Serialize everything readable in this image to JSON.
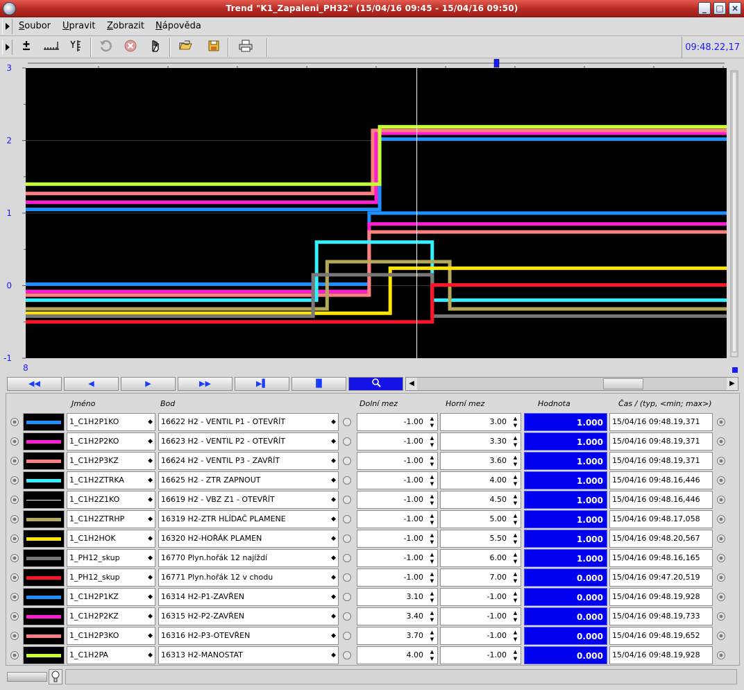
{
  "window": {
    "title": "Trend \"K1_Zapaleni_PH32\" (15/04/16 09:45 - 15/04/16 09:50)",
    "btn_minimize": "_",
    "btn_maximize": "□",
    "btn_close": "×"
  },
  "menu": [
    "Soubor",
    "Upravit",
    "Zobrazit",
    "Nápověda"
  ],
  "toolbar": {
    "clock": "09:48.22,17",
    "icons": [
      "plus-minus-icon",
      "time-axis-icon",
      "y-axis-icon",
      "undo-icon",
      "cancel-icon",
      "hand-icon",
      "open-icon",
      "save-icon",
      "print-icon"
    ]
  },
  "chart_data": {
    "type": "line",
    "x_range": [
      "09:45",
      "09:50"
    ],
    "ylim": [
      -1,
      3
    ],
    "y_ticks": [
      "3",
      "2",
      "1",
      "0",
      "-1"
    ],
    "x_start_label": "8",
    "cursor_x": "09:48.22,17",
    "grid": true,
    "background": "#000000",
    "series": [
      {
        "color": "#1e90ff",
        "steps": [
          {
            "t": 0.0,
            "y": 1.05
          },
          {
            "t": 0.505,
            "y": 2.02
          }
        ]
      },
      {
        "color": "#ff1ed2",
        "steps": [
          {
            "t": 0.0,
            "y": 1.15
          },
          {
            "t": 0.5,
            "y": 2.1
          }
        ]
      },
      {
        "color": "#ff8080",
        "steps": [
          {
            "t": 0.0,
            "y": 1.27
          },
          {
            "t": 0.495,
            "y": 2.14
          }
        ]
      },
      {
        "color": "#c8ff32",
        "steps": [
          {
            "t": 0.0,
            "y": 1.4
          },
          {
            "t": 0.505,
            "y": 2.19
          }
        ]
      },
      {
        "color": "#1e90ff",
        "steps": [
          {
            "t": 0.0,
            "y": 0.02
          },
          {
            "t": 0.49,
            "y": 1.0
          }
        ]
      },
      {
        "color": "#ff1ed2",
        "steps": [
          {
            "t": 0.0,
            "y": -0.08
          },
          {
            "t": 0.49,
            "y": 0.85
          }
        ]
      },
      {
        "color": "#ff8080",
        "steps": [
          {
            "t": 0.0,
            "y": -0.13
          },
          {
            "t": 0.49,
            "y": 0.74
          }
        ]
      },
      {
        "color": "#32f0ff",
        "steps": [
          {
            "t": 0.0,
            "y": -0.2
          },
          {
            "t": 0.415,
            "y": 0.6
          },
          {
            "t": 0.58,
            "y": -0.2
          }
        ]
      },
      {
        "color": "#b4aa5a",
        "steps": [
          {
            "t": 0.0,
            "y": -0.32
          },
          {
            "t": 0.43,
            "y": 0.33
          },
          {
            "t": 0.605,
            "y": -0.32
          }
        ]
      },
      {
        "color": "#ffe600",
        "steps": [
          {
            "t": 0.0,
            "y": -0.38
          },
          {
            "t": 0.52,
            "y": 0.24
          }
        ]
      },
      {
        "color": "#787878",
        "steps": [
          {
            "t": 0.0,
            "y": -0.42
          },
          {
            "t": 0.41,
            "y": 0.15
          },
          {
            "t": 0.58,
            "y": -0.42
          }
        ]
      },
      {
        "color": "#ff1428",
        "steps": [
          {
            "t": 0.0,
            "y": -0.5
          },
          {
            "t": 0.58,
            "y": 0.01
          }
        ]
      }
    ]
  },
  "nav": {
    "buttons": [
      "◀◀",
      "◀",
      "▶",
      "▶▶",
      "▶▌",
      "▐▌"
    ],
    "zoom_icon": "magnifier-icon"
  },
  "table": {
    "headers": {
      "name": "Jméno",
      "point": "Bod",
      "low": "Dolní mez",
      "high": "Horní mez",
      "value": "Hodnota",
      "time": "Čas / (typ, <min; max>)"
    },
    "rows": [
      {
        "color": "#1e90ff",
        "name": "1_C1H2P1KO",
        "point": "16622  H2 - VENTIL P1 - OTEVŘÍT",
        "low": "-1.00",
        "high": "3.00",
        "value": "1.000",
        "time": "15/04/16 09:48.19,371"
      },
      {
        "color": "#ff1ed2",
        "name": "1_C1H2P2KO",
        "point": "16623  H2 - VENTIL P2 - OTEVŘÍT",
        "low": "-1.00",
        "high": "3.30",
        "value": "1.000",
        "time": "15/04/16 09:48.19,371"
      },
      {
        "color": "#ff8080",
        "name": "1_C1H2P3KZ",
        "point": "16624  H2 - VENTIL P3 - ZAVŘÍT",
        "low": "-1.00",
        "high": "3.60",
        "value": "1.000",
        "time": "15/04/16 09:48.19,371"
      },
      {
        "color": "#32f0ff",
        "name": "1_C1H2ZTRKA",
        "point": "16625  H2 - ZTR ZAPNOUT",
        "low": "-1.00",
        "high": "4.00",
        "value": "1.000",
        "time": "15/04/16 09:48.16,446"
      },
      {
        "color": "#ffffff",
        "name": "1_C1H2Z1KO",
        "point": "16619  H2 - VBZ Z1 - OTEVŘÍT",
        "low": "-1.00",
        "high": "4.50",
        "value": "1.000",
        "time": "15/04/16 09:48.16,446"
      },
      {
        "color": "#b4aa5a",
        "name": "1_C1H2ZTRHP",
        "point": "16319  H2-ZTR HLÍDAČ PLAMENE",
        "low": "-1.00",
        "high": "5.00",
        "value": "1.000",
        "time": "15/04/16 09:48.17,058"
      },
      {
        "color": "#ffe600",
        "name": "1_C1H2HOK",
        "point": "16320  H2-HOŘÁK PLAMEN",
        "low": "-1.00",
        "high": "5.50",
        "value": "1.000",
        "time": "15/04/16 09:48.20,567"
      },
      {
        "color": "#787878",
        "name": "1_PH12_skup",
        "point": "16770  Plyn.hořák 12 najíždí",
        "low": "-1.00",
        "high": "6.00",
        "value": "1.000",
        "time": "15/04/16 09:48.16,165"
      },
      {
        "color": "#ff1428",
        "name": "1_PH12_skup",
        "point": "16771  Plyn.hořák 12  v chodu",
        "low": "-1.00",
        "high": "7.00",
        "value": "0.000",
        "time": "15/04/16 09:47.20,519"
      },
      {
        "color": "#1e90ff",
        "name": "1_C1H2P1KZ",
        "point": "16314  H2-P1-ZAVŘEN",
        "low": "3.10",
        "high": "-1.00",
        "value": "0.000",
        "time": "15/04/16 09:48.19,928"
      },
      {
        "color": "#ff1ed2",
        "name": "1_C1H2P2KZ",
        "point": "16315  H2-P2-ZAVŘEN",
        "low": "3.40",
        "high": "-1.00",
        "value": "0.000",
        "time": "15/04/16 09:48.19,733"
      },
      {
        "color": "#ff8080",
        "name": "1_C1H2P3KO",
        "point": "16316  H2-P3-OTEVŘEN",
        "low": "3.70",
        "high": "-1.00",
        "value": "0.000",
        "time": "15/04/16 09:48.19,652"
      },
      {
        "color": "#c8ff32",
        "name": "1_C1H2PA",
        "point": "16313  H2-MANOSTAT",
        "low": "4.00",
        "high": "-1.00",
        "value": "0.000",
        "time": "15/04/16 09:48.19,928"
      }
    ]
  }
}
